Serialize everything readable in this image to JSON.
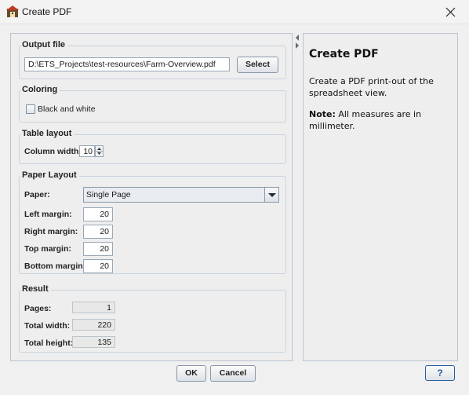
{
  "window": {
    "title": "Create PDF",
    "icon": "app-icon",
    "close_icon": "close-icon"
  },
  "output_file": {
    "title": "Output file",
    "path_value": "D:\\ETS_Projects\\test-resources\\Farm-Overview.pdf",
    "select_label": "Select"
  },
  "coloring": {
    "title": "Coloring",
    "black_white_label": "Black and white",
    "black_white_checked": false
  },
  "table_layout": {
    "title": "Table layout",
    "column_width_label": "Column width:",
    "column_width_value": "10"
  },
  "paper_layout": {
    "title": "Paper Layout",
    "paper_label": "Paper:",
    "paper_value": "Single Page",
    "left_margin_label": "Left margin:",
    "left_margin_value": "20",
    "right_margin_label": "Right margin:",
    "right_margin_value": "20",
    "top_margin_label": "Top margin:",
    "top_margin_value": "20",
    "bottom_margin_label": "Bottom margin:",
    "bottom_margin_value": "20"
  },
  "result": {
    "title": "Result",
    "pages_label": "Pages:",
    "pages_value": "1",
    "total_width_label": "Total width:",
    "total_width_value": "220",
    "total_height_label": "Total height:",
    "total_height_value": "135"
  },
  "help": {
    "title": "Create PDF",
    "description": "Create a PDF print-out of the spreadsheet view.",
    "note_label": "Note:",
    "note_text": " All measures are in millimeter."
  },
  "buttons": {
    "ok_label": "OK",
    "cancel_label": "Cancel",
    "help_label": "?"
  }
}
